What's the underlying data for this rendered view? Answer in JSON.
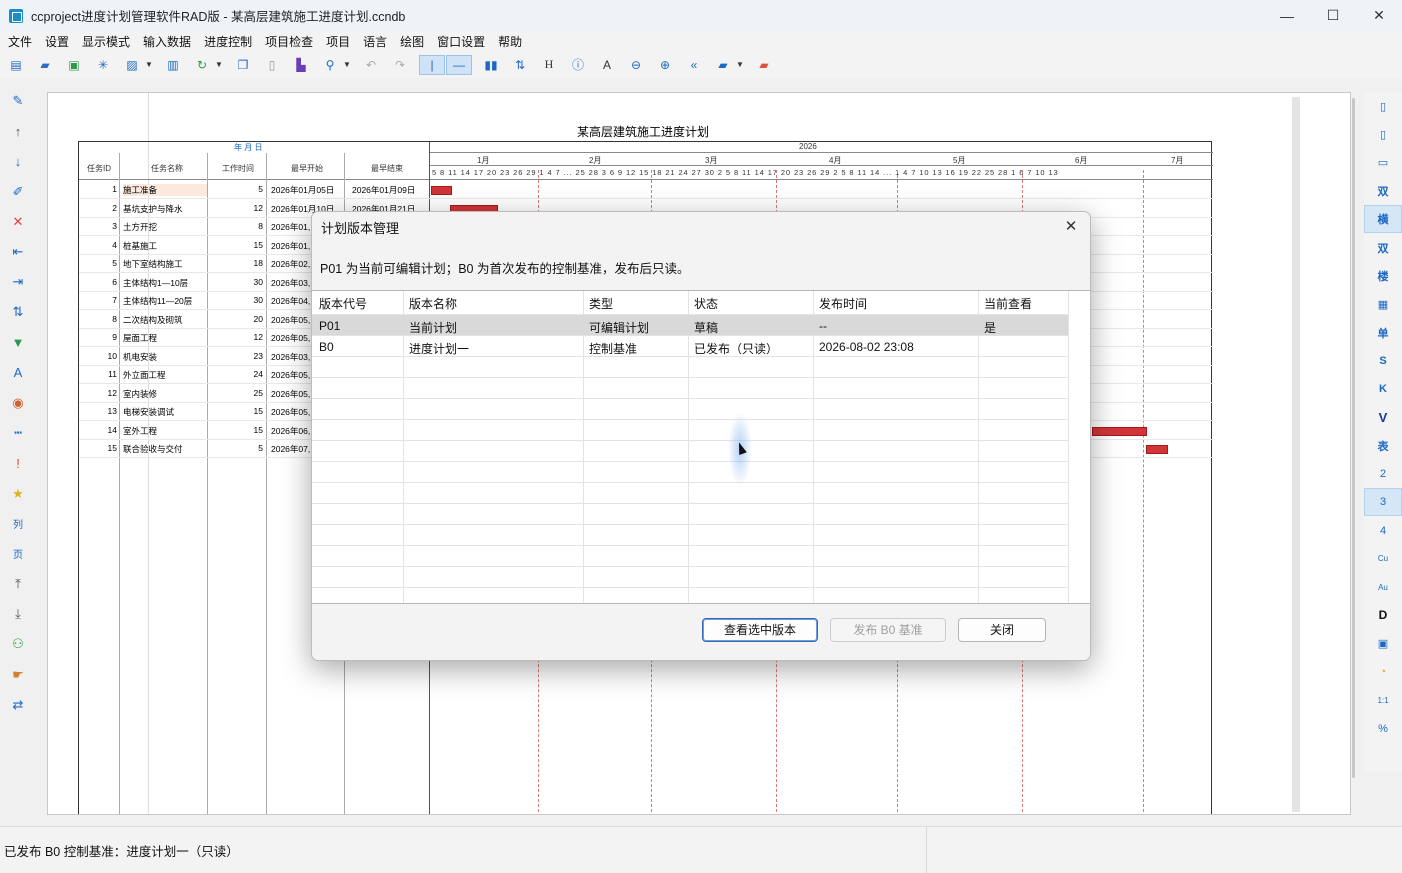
{
  "window": {
    "title": "ccproject进度计划管理软件RAD版 - 某高层建筑施工进度计划.ccndb",
    "minimize": "—",
    "maximize": "☐",
    "close": "✕"
  },
  "menu": [
    "文件",
    "设置",
    "显示模式",
    "输入数据",
    "进度控制",
    "项目检查",
    "项目",
    "语言",
    "绘图",
    "窗口设置",
    "帮助"
  ],
  "right_toolbar": [
    "双",
    "横",
    "双",
    "楼",
    "▦",
    "单",
    "S",
    "K",
    "V",
    "表",
    "2",
    "3",
    "4",
    "Cu",
    "Au",
    "D"
  ],
  "gantt": {
    "title": "某高层建筑施工进度计划",
    "year": "2026",
    "date_header": "年 月 日",
    "columns": [
      "任务ID",
      "任务名称",
      "工作时间",
      "最早开始",
      "最早结束"
    ],
    "months": [
      "1月",
      "2月",
      "3月",
      "4月",
      "5月",
      "6月",
      "7月"
    ],
    "days_header": "5 8 11 14 17 20 23 26 29 1 4 7 ... 25 28 3 6 9 12 15 18 21 24 27 30 2 5 8 11 14 17 20 23 26 29 2 5 8 11 14 ... 1 4 7 10 13 16 19 22 25 28 1 6 7 10 13",
    "tasks": [
      {
        "id": "1",
        "name": "施工准备",
        "dur": "5",
        "start": "2026年01月05日",
        "end": "2026年01月09日"
      },
      {
        "id": "2",
        "name": "基坑支护与降水",
        "dur": "12",
        "start": "2026年01月10日",
        "end": "2026年01月21日"
      },
      {
        "id": "3",
        "name": "土方开挖",
        "dur": "8",
        "start": "2026年01,",
        "end": ""
      },
      {
        "id": "4",
        "name": "桩基施工",
        "dur": "15",
        "start": "2026年01,",
        "end": ""
      },
      {
        "id": "5",
        "name": "地下室结构施工",
        "dur": "18",
        "start": "2026年02,",
        "end": ""
      },
      {
        "id": "6",
        "name": "主体结构1—10层",
        "dur": "30",
        "start": "2026年03,",
        "end": ""
      },
      {
        "id": "7",
        "name": "主体结构11—20层",
        "dur": "30",
        "start": "2026年04,",
        "end": ""
      },
      {
        "id": "8",
        "name": "二次结构及砌筑",
        "dur": "20",
        "start": "2026年05,",
        "end": ""
      },
      {
        "id": "9",
        "name": "屋面工程",
        "dur": "12",
        "start": "2026年05,",
        "end": ""
      },
      {
        "id": "10",
        "name": "机电安装",
        "dur": "23",
        "start": "2026年03,",
        "end": ""
      },
      {
        "id": "11",
        "name": "外立面工程",
        "dur": "24",
        "start": "2026年05,",
        "end": ""
      },
      {
        "id": "12",
        "name": "室内装修",
        "dur": "25",
        "start": "2026年05,",
        "end": ""
      },
      {
        "id": "13",
        "name": "电梯安装调试",
        "dur": "15",
        "start": "2026年05,",
        "end": ""
      },
      {
        "id": "14",
        "name": "室外工程",
        "dur": "15",
        "start": "2026年06,",
        "end": ""
      },
      {
        "id": "15",
        "name": "联合验收与交付",
        "dur": "5",
        "start": "2026年07,",
        "end": ""
      }
    ]
  },
  "dialog": {
    "title": "计划版本管理",
    "close": "✕",
    "description": "P01 为当前可编辑计划；B0 为首次发布的控制基准，发布后只读。",
    "columns": [
      "版本代号",
      "版本名称",
      "类型",
      "状态",
      "发布时间",
      "当前查看"
    ],
    "rows": [
      {
        "code": "P01",
        "name": "当前计划",
        "type": "可编辑计划",
        "status": "草稿",
        "time": "--",
        "current": "是"
      },
      {
        "code": "B0",
        "name": "进度计划一",
        "type": "控制基准",
        "status": "已发布（只读）",
        "time": "2026-08-02 23:08",
        "current": ""
      }
    ],
    "buttons": {
      "view": "查看选中版本",
      "publish": "发布 B0 基准",
      "close": "关闭"
    }
  },
  "status": {
    "text": "已发布 B0 控制基准：进度计划一（只读）"
  }
}
